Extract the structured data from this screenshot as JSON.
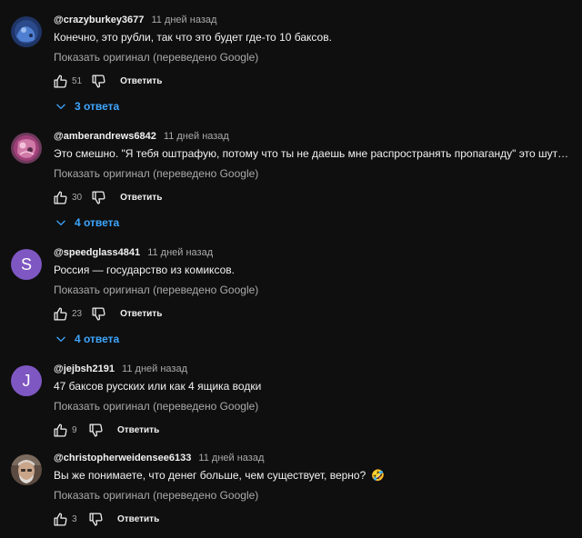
{
  "comments": [
    {
      "author": "@crazyburkey3677",
      "time": "11 дней назад",
      "text": "Конечно, это рубли, так что это будет где-то 10 баксов.",
      "translate": "Показать оригинал (переведено Google)",
      "likes": "51",
      "reply_label": "Ответить",
      "replies": "3 ответа",
      "avatar": {
        "icon": "blue-photo-avatar-icon",
        "color": "#2b4a8c"
      }
    },
    {
      "author": "@amberandrews6842",
      "time": "11 дней назад",
      "text": "Это смешно. \"Я тебя оштрафую, потому что ты не даешь мне распространять пропаганду\" это шутка...",
      "translate": "Показать оригинал (переведено Google)",
      "likes": "30",
      "reply_label": "Ответить",
      "replies": "4 ответа",
      "avatar": {
        "icon": "floral-art-avatar-icon",
        "color": "#a0407a"
      }
    },
    {
      "author": "@speedglass4841",
      "time": "11 дней назад",
      "text": "Россия — государство из комиксов.",
      "translate": "Показать оригинал (переведено Google)",
      "likes": "23",
      "reply_label": "Ответить",
      "replies": "4 ответа",
      "avatar": {
        "letter": "S",
        "color": "#7e57c2"
      }
    },
    {
      "author": "@jejbsh2191",
      "time": "11 дней назад",
      "text": "47 баксов русских или как 4 ящика водки",
      "translate": "Показать оригинал (переведено Google)",
      "likes": "9",
      "reply_label": "Ответить",
      "avatar": {
        "letter": "J",
        "color": "#7e57c2"
      }
    },
    {
      "author": "@christopherweidensee6133",
      "time": "11 дней назад",
      "text": "Вы же понимаете, что денег больше, чем существует, верно?",
      "emoji": "🤣",
      "translate": "Показать оригинал (переведено Google)",
      "likes": "3",
      "reply_label": "Ответить",
      "avatar": {
        "icon": "man-photo-avatar-icon",
        "color": "#8a6a55"
      }
    }
  ],
  "icons": {
    "like": "thumbs-up-icon",
    "dislike": "thumbs-down-icon",
    "expand": "chevron-down-icon"
  }
}
